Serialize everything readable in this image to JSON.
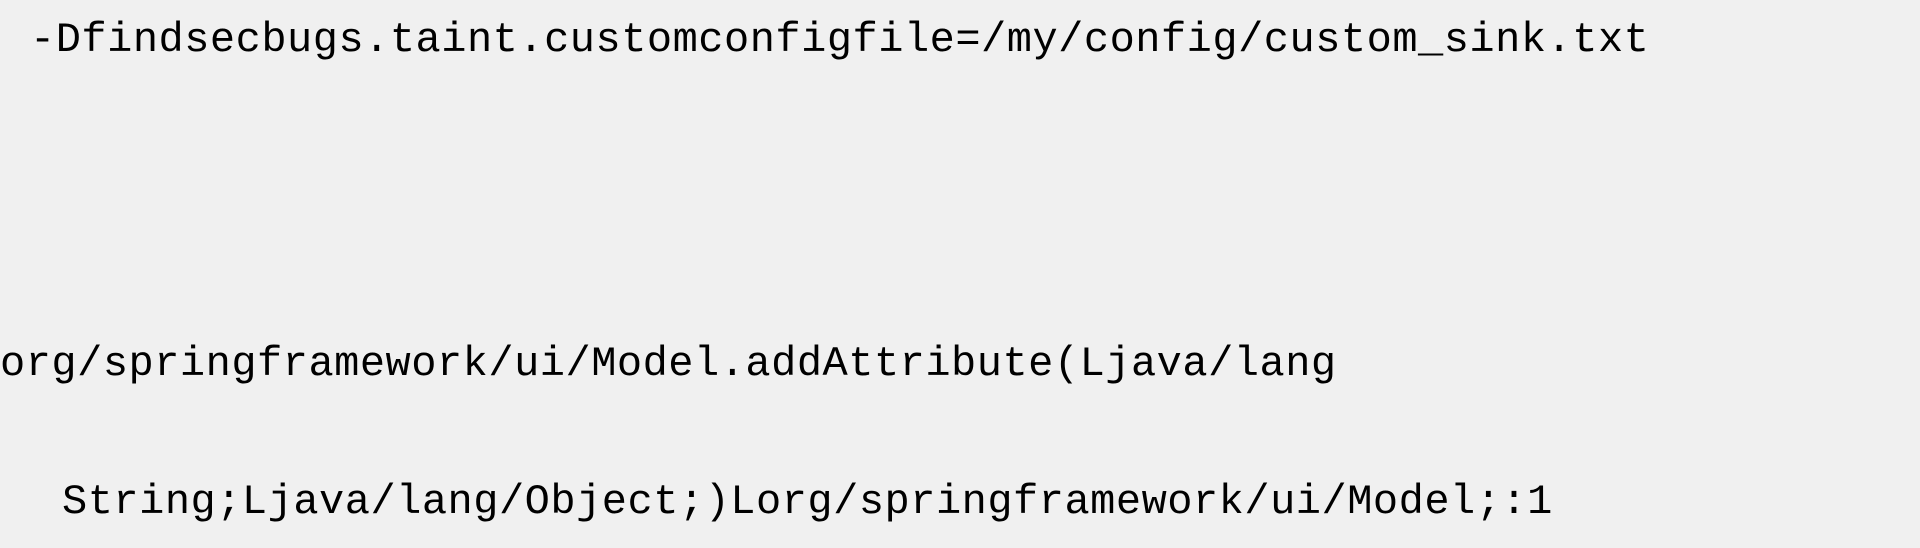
{
  "code": {
    "line1": "-Dfindsecbugs.taint.customconfigfile=/my/config/custom_sink.txt",
    "line2": "org/springframework/ui/Model.addAttribute(Ljava/lang",
    "line3": "String;Ljava/lang/Object;)Lorg/springframework/ui/Model;:1"
  }
}
